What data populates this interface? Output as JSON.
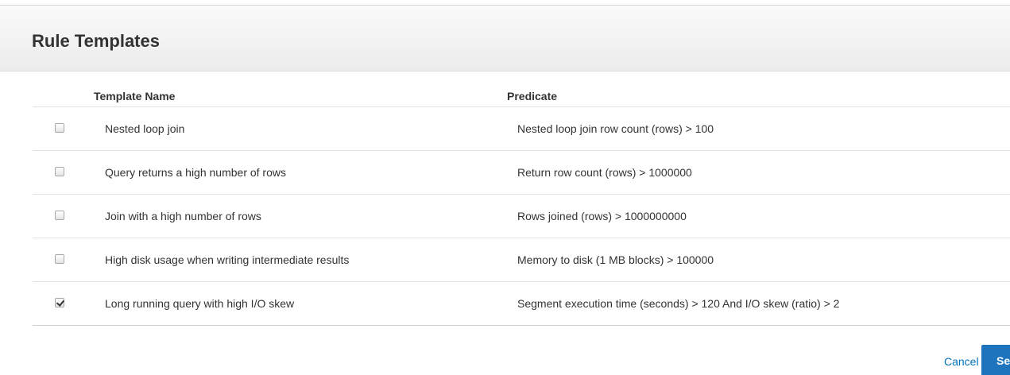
{
  "modal": {
    "title": "Rule Templates"
  },
  "table": {
    "columns": {
      "template_name": "Template Name",
      "predicate": "Predicate"
    },
    "rows": [
      {
        "checked": false,
        "name": "Nested loop join",
        "predicate": "Nested loop join row count (rows) > 100"
      },
      {
        "checked": false,
        "name": "Query returns a high number of rows",
        "predicate": "Return row count (rows) > 1000000"
      },
      {
        "checked": false,
        "name": "Join with a high number of rows",
        "predicate": "Rows joined (rows) > 1000000000"
      },
      {
        "checked": false,
        "name": "High disk usage when writing intermediate results",
        "predicate": "Memory to disk (1 MB blocks) > 100000"
      },
      {
        "checked": true,
        "name": "Long running query with high I/O skew",
        "predicate": "Segment execution time (seconds) > 120 And I/O skew (ratio) > 2"
      }
    ]
  },
  "footer": {
    "cancel_label": "Cancel",
    "primary_label": "Se"
  },
  "colors": {
    "link": "#0073bb",
    "primary_button": "#1f75bd"
  }
}
